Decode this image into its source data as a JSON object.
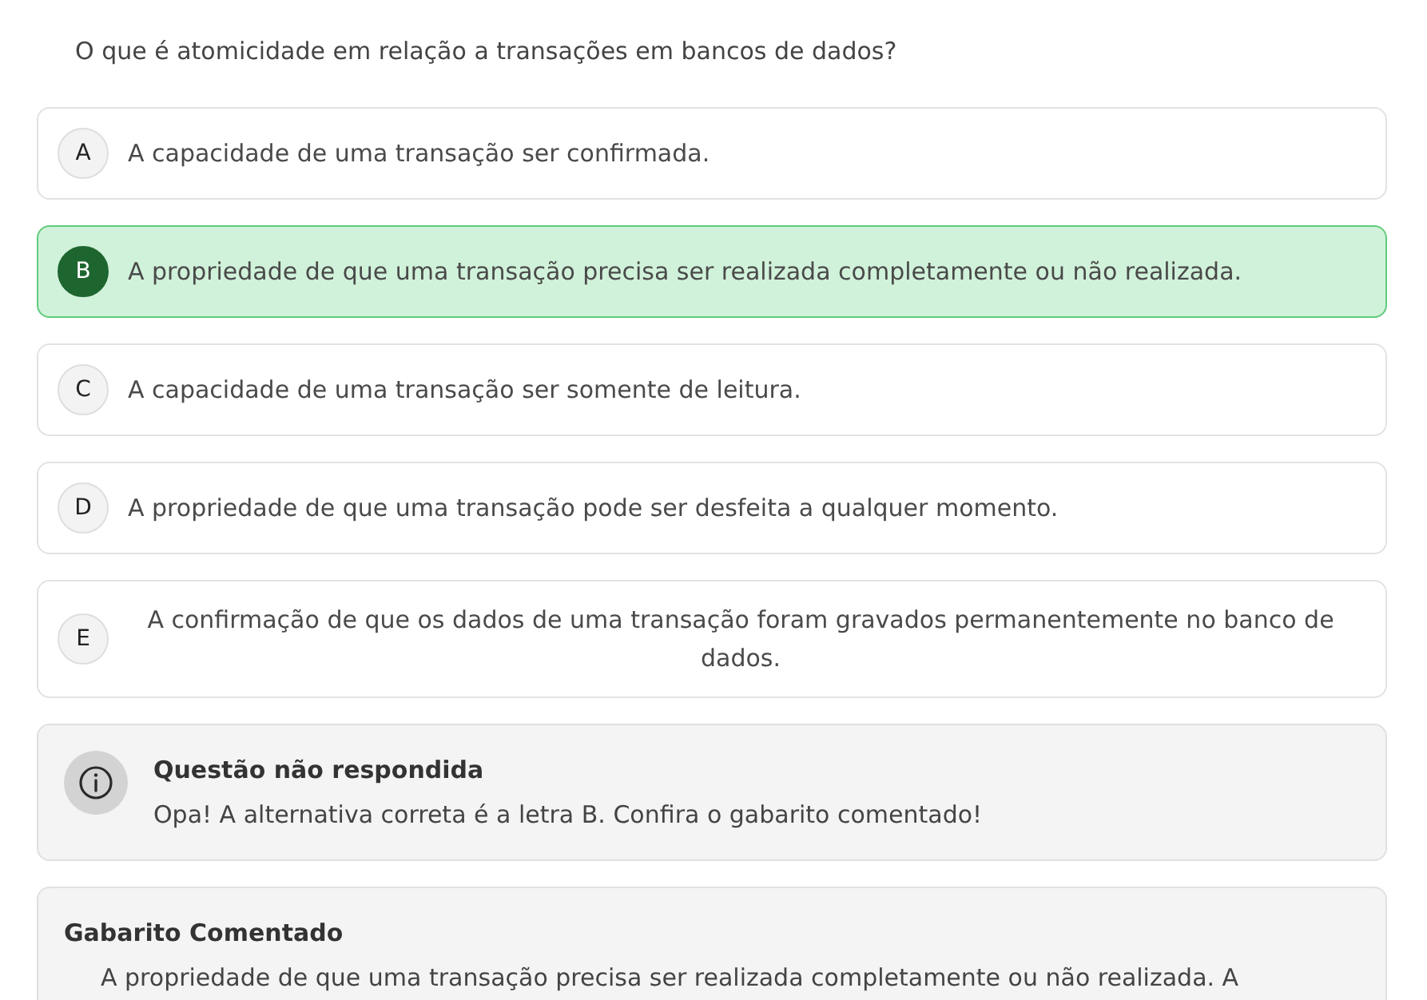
{
  "question": {
    "text": "O que é atomicidade em relação a transações em bancos de dados?"
  },
  "options": [
    {
      "letter": "A",
      "text": "A capacidade de uma transação ser confirmada.",
      "correct": false
    },
    {
      "letter": "B",
      "text": "A propriedade de que uma transação precisa ser realizada completamente ou não realizada.",
      "correct": true
    },
    {
      "letter": "C",
      "text": "A capacidade de uma transação ser somente de leitura.",
      "correct": false
    },
    {
      "letter": "D",
      "text": "A propriedade de que uma transação pode ser desfeita a qualquer momento.",
      "correct": false
    },
    {
      "letter": "E",
      "text": "A confirmação de que os dados de uma transação foram gravados permanentemente no banco de dados.",
      "correct": false
    }
  ],
  "feedback": {
    "title": "Questão não respondida",
    "message": "Opa! A alternativa correta é a letra B. Confira o gabarito comentado!"
  },
  "commentary": {
    "title": "Gabarito Comentado",
    "text": "A propriedade de que uma transação precisa ser realizada completamente ou não realizada. A"
  }
}
